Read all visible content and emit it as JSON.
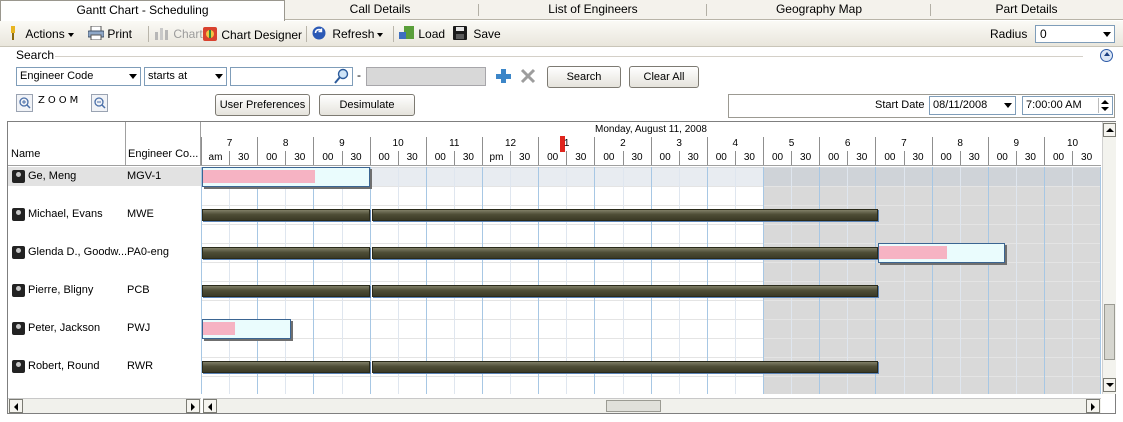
{
  "tabs": [
    {
      "label": "Gantt Chart - Scheduling",
      "selected": true
    },
    {
      "label": "Call Details"
    },
    {
      "label": "List of Engineers"
    },
    {
      "label": "Geography Map"
    },
    {
      "label": "Part Details"
    }
  ],
  "toolbar": {
    "actions": "Actions",
    "print": "Print",
    "chart": "Chart",
    "chart_designer": "Chart Designer",
    "refresh": "Refresh",
    "load": "Load",
    "save": "Save",
    "radius_label": "Radius",
    "radius_value": "0"
  },
  "search": {
    "title": "Search",
    "field_select": "Engineer Code",
    "operator_select": "starts at",
    "value": "",
    "dash": "-",
    "search_button": "Search",
    "clear_all_button": "Clear All"
  },
  "zoom": {
    "label": "ZOOM",
    "user_preferences_button": "User Preferences",
    "desimulate_button": "Desimulate",
    "start_date_label": "Start Date",
    "start_date": "08/11/2008",
    "start_time": "7:00:00 AM"
  },
  "grid": {
    "columns": {
      "name": "Name",
      "code": "Engineer Co..."
    },
    "day_label": "Monday, August 11, 2008",
    "hours": [
      "7",
      "8",
      "9",
      "10",
      "11",
      "12",
      "1",
      "2",
      "3",
      "4",
      "5",
      "6",
      "7",
      "8",
      "9",
      "10"
    ],
    "half_labels": [
      "am",
      "30",
      "00",
      "30",
      "00",
      "30",
      "00",
      "30",
      "00",
      "30",
      "pm",
      "30",
      "00",
      "30",
      "00",
      "30",
      "00",
      "30",
      "00",
      "30",
      "00",
      "30",
      "00",
      "30",
      "00",
      "30",
      "00",
      "30",
      "00",
      "30",
      "00",
      "30"
    ],
    "engineers": [
      {
        "name": "Ge, Meng",
        "code": "MGV-1"
      },
      {
        "name": "Michael, Evans",
        "code": "MWE"
      },
      {
        "name": "Glenda D., Goodw...",
        "code": "PA0-eng"
      },
      {
        "name": "Pierre, Bligny",
        "code": "PCB"
      },
      {
        "name": "Peter, Jackson",
        "code": "PWJ"
      },
      {
        "name": "Robert, Round",
        "code": "RWR"
      }
    ]
  },
  "colors": {
    "bar_dark": "#4e4d36",
    "bar_light": "#eafcfd",
    "bar_progress": "#f6b3c3",
    "now_marker": "#e0251d",
    "off_hours": "#d9d9d9"
  }
}
